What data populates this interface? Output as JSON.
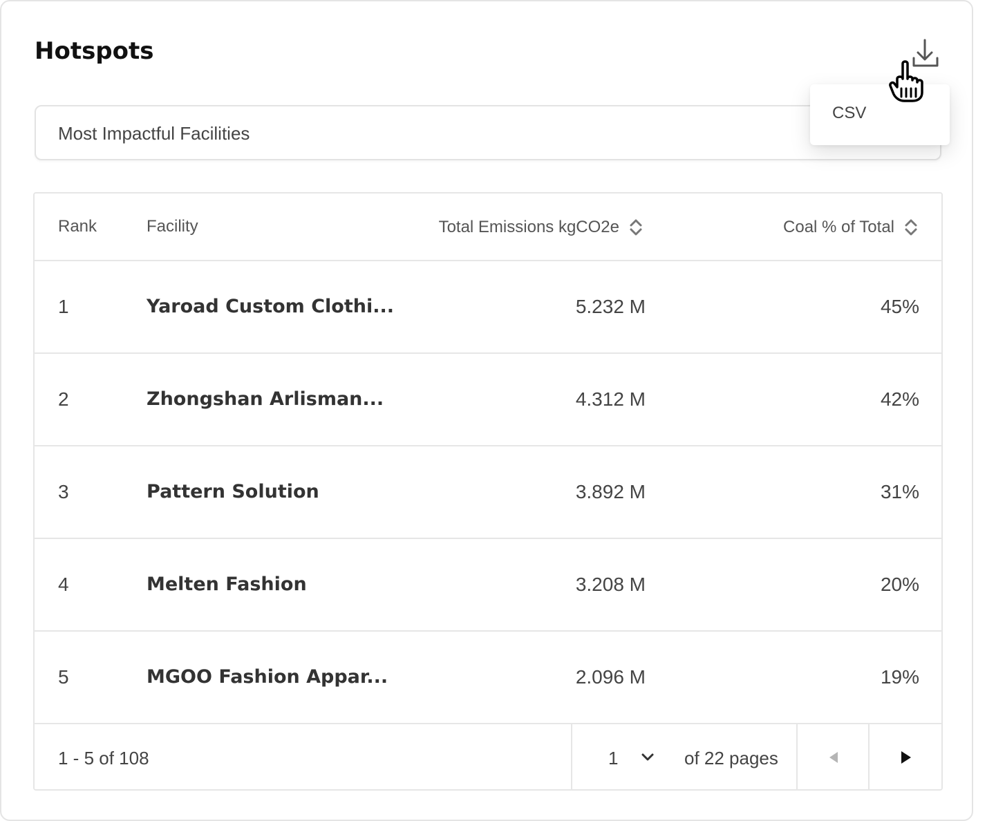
{
  "header": {
    "title": "Hotspots"
  },
  "filter": {
    "selected": "Most Impactful Facilities"
  },
  "table": {
    "columns": {
      "rank": "Rank",
      "facility": "Facility",
      "emissions": "Total Emissions kgCO2e",
      "coal": "Coal % of Total"
    },
    "rows": [
      {
        "rank": "1",
        "facility": "Yaroad Custom Clothi...",
        "emissions": "5.232 M",
        "coal": "45%"
      },
      {
        "rank": "2",
        "facility": "Zhongshan Arlisman...",
        "emissions": "4.312 M",
        "coal": "42%"
      },
      {
        "rank": "3",
        "facility": "Pattern Solution",
        "emissions": "3.892 M",
        "coal": "31%"
      },
      {
        "rank": "4",
        "facility": "Melten Fashion",
        "emissions": "3.208 M",
        "coal": "20%"
      },
      {
        "rank": "5",
        "facility": "MGOO Fashion Appar...",
        "emissions": "2.096 M",
        "coal": "19%"
      }
    ]
  },
  "pagination": {
    "range": "1 - 5 of 108",
    "current_page": "1",
    "total_pages": "of 22 pages"
  },
  "download_menu": {
    "items": [
      "CSV"
    ]
  },
  "icons": {
    "download": "download-icon",
    "sort": "sort-icon",
    "chevron": "chevron-down-icon",
    "prev": "prev-page-icon",
    "next": "next-page-icon",
    "cursor": "hand-pointer-icon"
  }
}
